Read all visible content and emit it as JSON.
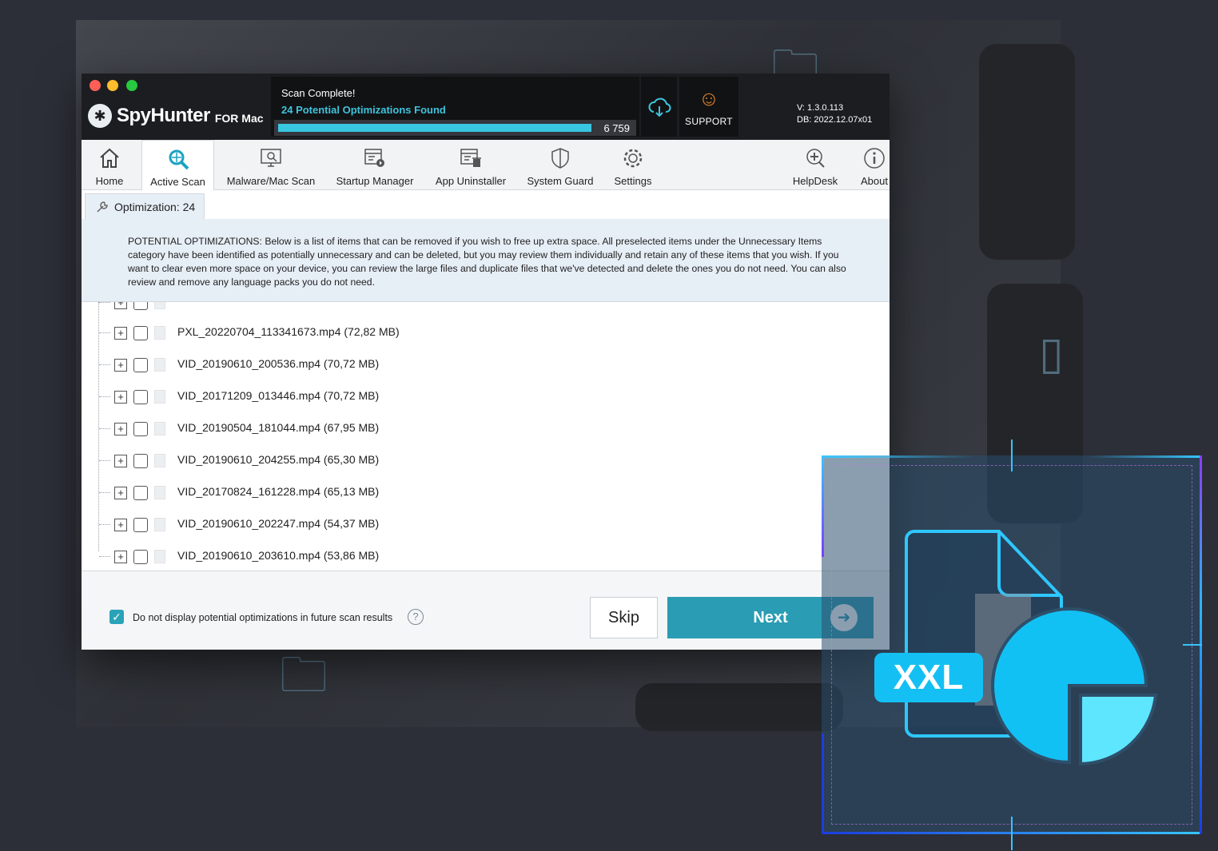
{
  "app": {
    "name": "SpyHunter",
    "sub": "FOR Mac",
    "version": "V: 1.3.0.113",
    "db": "DB:  2022.12.07x01"
  },
  "scan": {
    "title": "Scan Complete!",
    "found": "24 Potential Optimizations Found",
    "count": "6 759",
    "progress_fraction": 1.0
  },
  "support_label": "SUPPORT",
  "toolbar": [
    {
      "label": "Home",
      "icon": "home-icon"
    },
    {
      "label": "Active Scan",
      "icon": "active-scan-icon",
      "active": true
    },
    {
      "label": "Malware/Mac Scan",
      "icon": "malware-scan-icon"
    },
    {
      "label": "Startup Manager",
      "icon": "startup-manager-icon"
    },
    {
      "label": "App Uninstaller",
      "icon": "app-uninstaller-icon"
    },
    {
      "label": "System Guard",
      "icon": "shield-icon"
    },
    {
      "label": "Settings",
      "icon": "gear-icon"
    },
    {
      "label": "HelpDesk",
      "icon": "helpdesk-icon"
    },
    {
      "label": "About",
      "icon": "info-icon"
    }
  ],
  "tab": {
    "label": "Optimization: 24"
  },
  "description": "POTENTIAL OPTIMIZATIONS: Below is a list of items that can be removed if you wish to free up extra space. All preselected items under the Unnecessary Items category have been identified as potentially unnecessary and can be deleted, but you may review them individually and retain any of these items that you wish. If you want to clear even more space on your device, you can review the large files and duplicate files that we've detected and delete the ones you do not need. You can also review and remove any language packs you do not need.",
  "files": [
    {
      "name": "PXL_20220704_113341673.mp4 (72,82 MB)",
      "checked": false
    },
    {
      "name": "VID_20190610_200536.mp4 (70,72 MB)",
      "checked": false
    },
    {
      "name": "VID_20171209_013446.mp4 (70,72 MB)",
      "checked": false
    },
    {
      "name": "VID_20190504_181044.mp4 (67,95 MB)",
      "checked": false
    },
    {
      "name": "VID_20190610_204255.mp4 (65,30 MB)",
      "checked": false
    },
    {
      "name": "VID_20170824_161228.mp4 (65,13 MB)",
      "checked": false
    },
    {
      "name": "VID_20190610_202247.mp4 (54,37 MB)",
      "checked": false
    },
    {
      "name": "VID_20190610_203610.mp4 (53,86 MB)",
      "checked": false
    }
  ],
  "footer": {
    "checkbox_label": "Do not display potential optimizations in future scan results",
    "checkbox_checked": true,
    "skip_label": "Skip",
    "next_label": "Next"
  },
  "overlay": {
    "badge": "XXL"
  },
  "colors": {
    "accent": "#2a9cb3",
    "scan_text": "#3fc3dd",
    "overlay_cyan": "#14c0f3"
  }
}
